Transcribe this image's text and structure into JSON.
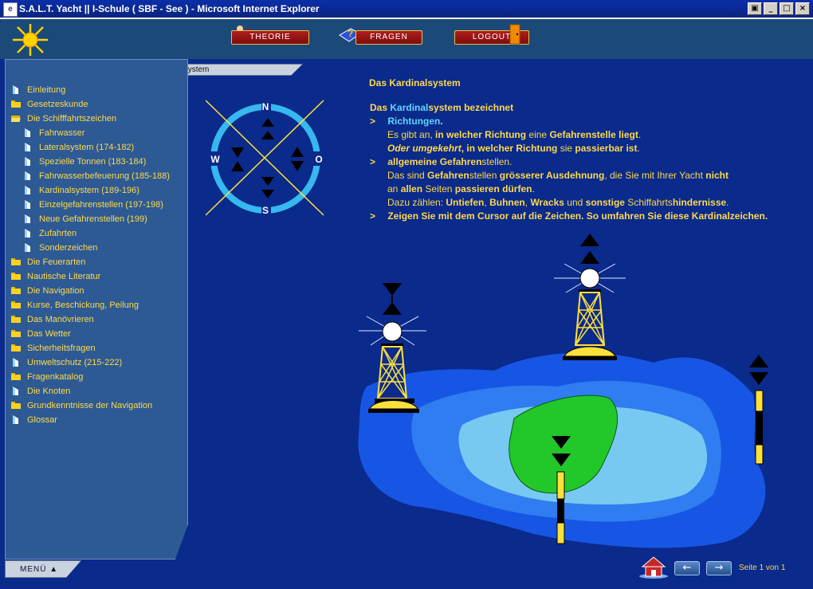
{
  "window": {
    "title": "S.A.L.T. Yacht || I-Schule ( SBF - See ) - Microsoft Internet Explorer"
  },
  "header": {
    "buttons": [
      {
        "label": "THEORIE"
      },
      {
        "label": "FRAGEN"
      },
      {
        "label": "LOGOUT"
      }
    ],
    "breadcrumb": "Schifffahrtszeichen / Das Kardinalsystem"
  },
  "sidebar": {
    "items": [
      {
        "label": "Einleitung",
        "icon": "page-icon"
      },
      {
        "label": "Gesetzeskunde",
        "icon": "folder-icon"
      },
      {
        "label": "Die Schifffahrtszeichen",
        "icon": "folder-open-icon"
      },
      {
        "label": "Fahrwasser",
        "icon": "page-icon"
      },
      {
        "label": "Lateralsystem (174-182)",
        "icon": "page-icon"
      },
      {
        "label": "Spezielle Tonnen (183-184)",
        "icon": "page-icon"
      },
      {
        "label": "Fahrwasserbefeuerung (185-188)",
        "icon": "page-icon"
      },
      {
        "label": "Kardinalsystem (189-196)",
        "icon": "page-icon"
      },
      {
        "label": "Einzelgefahrenstellen (197-198)",
        "icon": "page-icon"
      },
      {
        "label": "Neue Gefahrenstellen (199)",
        "icon": "page-icon"
      },
      {
        "label": "Zufahrten",
        "icon": "page-icon"
      },
      {
        "label": "Sonderzeichen",
        "icon": "page-icon"
      },
      {
        "label": "Die Feuerarten",
        "icon": "folder-icon"
      },
      {
        "label": "Nautische Literatur",
        "icon": "folder-icon"
      },
      {
        "label": "Die Navigation",
        "icon": "folder-icon"
      },
      {
        "label": "Kurse, Beschickung, Peilung",
        "icon": "folder-icon"
      },
      {
        "label": "Das Manövrieren",
        "icon": "folder-icon"
      },
      {
        "label": "Das Wetter",
        "icon": "folder-icon"
      },
      {
        "label": "Sicherheitsfragen",
        "icon": "folder-icon"
      },
      {
        "label": "Umweltschutz (215-222)",
        "icon": "page-icon"
      },
      {
        "label": "Fragenkatalog",
        "icon": "folder-icon"
      },
      {
        "label": "Die Knoten",
        "icon": "page-icon"
      },
      {
        "label": "Grundkenntnisse der Navigation",
        "icon": "folder-icon"
      },
      {
        "label": "Glossar",
        "icon": "page-icon"
      }
    ],
    "menu_label": "MENÜ"
  },
  "content": {
    "title": "Das Kardinalsystem",
    "compass": {
      "n": "N",
      "o": "O",
      "s": "S",
      "w": "W"
    },
    "l1": {
      "a": "Das",
      "b": "Kardinal",
      "c": "system bezeichnet"
    },
    "l2": {
      "bullet": ">",
      "a": "Richtungen",
      "b": "."
    },
    "l3": {
      "a": "Es gibt an,",
      "b": "in welcher Richtung",
      "c": "eine",
      "d": "Gefahrenstelle",
      "e": "liegt",
      "f": "."
    },
    "l4": {
      "a": "Oder umgekehrt",
      "b": ", in welcher Richtung",
      "c": "sie",
      "d": "passierbar ist",
      "e": "."
    },
    "l5": {
      "bullet": ">",
      "a": "allgemeine Gefahren",
      "b": "stellen."
    },
    "l6": {
      "a": "Das sind",
      "b": "Gefahren",
      "c": "stellen",
      "d": "grösserer Ausdehnung",
      "e": ", die Sie mit Ihrer Yacht",
      "f": "nicht"
    },
    "l7": {
      "a": "an",
      "b": "allen",
      "c": "Seiten",
      "d": "passieren dürfen",
      "e": "."
    },
    "l8": {
      "a": "Dazu zählen:",
      "b": "Untiefen",
      "c": ",",
      "d": "Buhnen",
      "e": ",",
      "f": "Wracks",
      "g": "und",
      "h": "sonstige",
      "i": "Schiffahrts",
      "j": "hindernisse",
      "k": "."
    },
    "l9": {
      "bullet": ">",
      "a": "Zeigen Sie mit dem Cursor auf die Zeichen. So umfahren Sie diese Kardinalzeichen."
    }
  },
  "footer": {
    "back_label": "←",
    "next_label": "→",
    "page_info": "Seite 1 von 1"
  },
  "colors": {
    "accent_text": "#ffd94a",
    "highlight": "#5fd6ff",
    "background": "#0a2a8c"
  }
}
